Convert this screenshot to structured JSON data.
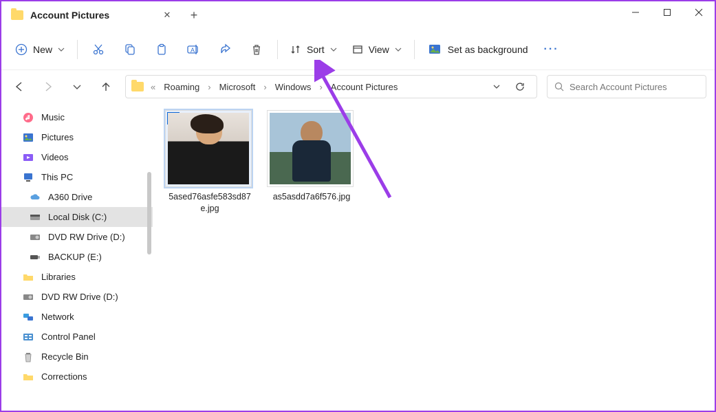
{
  "tab": {
    "title": "Account Pictures"
  },
  "toolbar": {
    "new_label": "New",
    "sort_label": "Sort",
    "view_label": "View",
    "setbg_label": "Set as background"
  },
  "breadcrumb": {
    "prefix": "«",
    "items": [
      "Roaming",
      "Microsoft",
      "Windows",
      "Account Pictures"
    ]
  },
  "search": {
    "placeholder": "Search Account Pictures"
  },
  "sidebar": {
    "items": [
      {
        "label": "Music",
        "icon": "music"
      },
      {
        "label": "Pictures",
        "icon": "pictures"
      },
      {
        "label": "Videos",
        "icon": "videos"
      },
      {
        "label": "This PC",
        "icon": "thispc"
      },
      {
        "label": "A360 Drive",
        "icon": "a360",
        "indent": true
      },
      {
        "label": "Local Disk (C:)",
        "icon": "disk",
        "indent": true,
        "selected": true
      },
      {
        "label": "DVD RW Drive (D:)",
        "icon": "dvd",
        "indent": true
      },
      {
        "label": "BACKUP (E:)",
        "icon": "usb",
        "indent": true
      },
      {
        "label": "Libraries",
        "icon": "folder"
      },
      {
        "label": "DVD RW Drive (D:)",
        "icon": "dvd"
      },
      {
        "label": "Network",
        "icon": "network"
      },
      {
        "label": "Control Panel",
        "icon": "control"
      },
      {
        "label": "Recycle Bin",
        "icon": "recycle"
      },
      {
        "label": "Corrections",
        "icon": "folder"
      }
    ]
  },
  "files": [
    {
      "name": "5ased76asfe583sd87e.jpg",
      "selected": true
    },
    {
      "name": "as5asdd7a6f576.jpg",
      "selected": false
    }
  ]
}
